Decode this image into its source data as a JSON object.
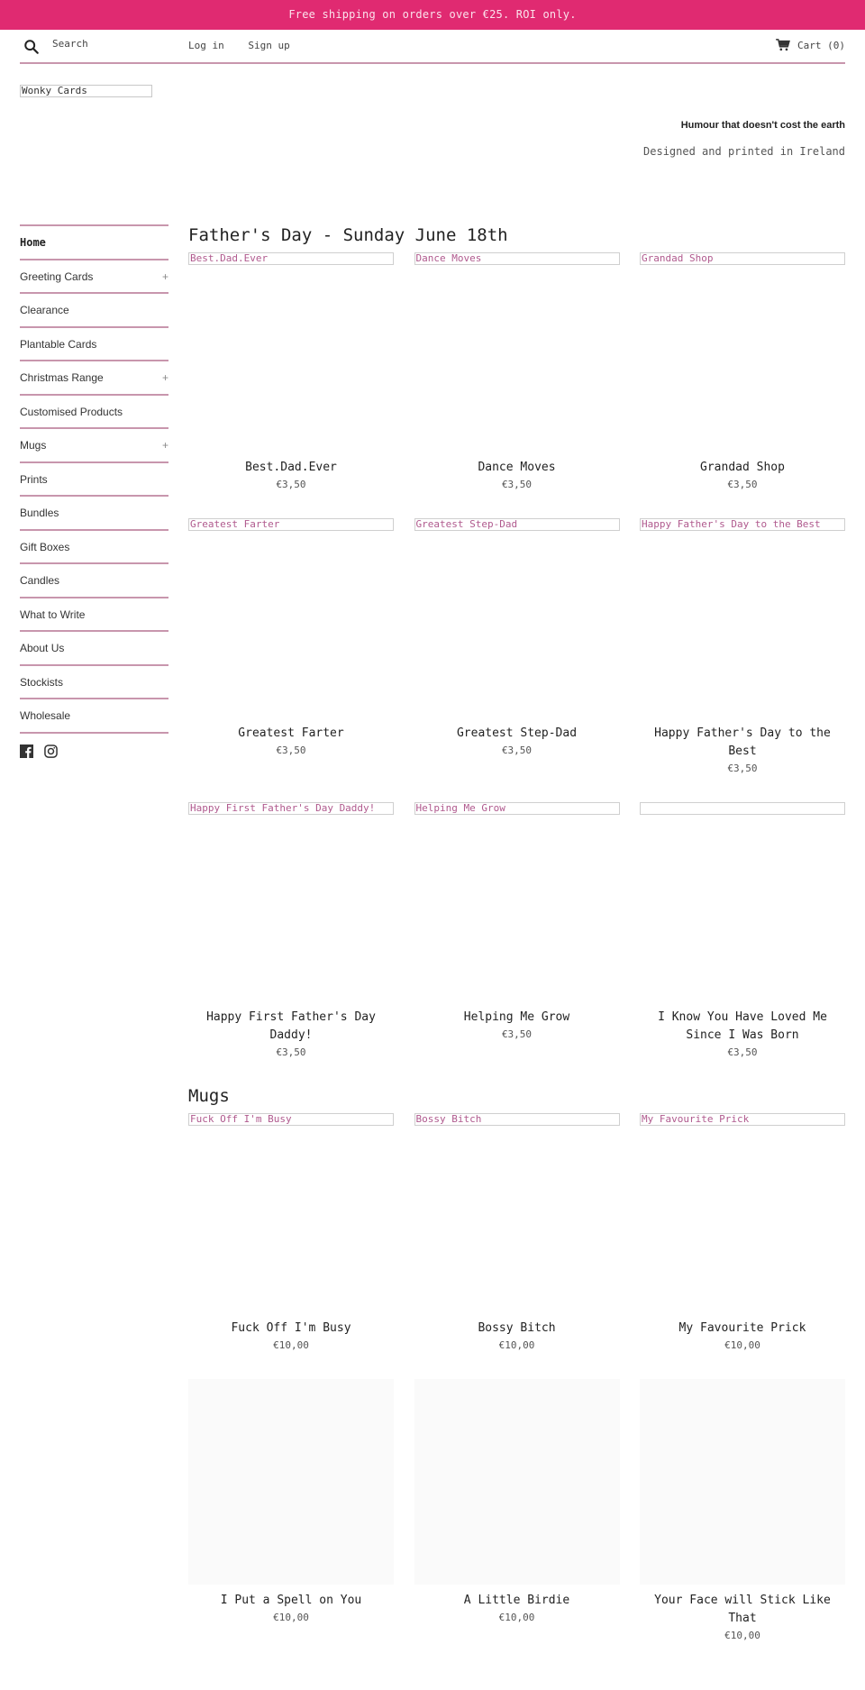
{
  "announcement": "Free shipping on orders over €25. ROI only.",
  "header": {
    "search_placeholder": "Search",
    "login": "Log in",
    "signup": "Sign up",
    "cart": "Cart (0)"
  },
  "store": {
    "logo_alt": "Wonky Cards",
    "tagline": "Humour that doesn't cost the earth",
    "subtag": "Designed and printed in Ireland"
  },
  "sidebar": {
    "items": [
      {
        "label": "Home",
        "active": true,
        "expandable": false
      },
      {
        "label": "Greeting Cards",
        "expandable": true
      },
      {
        "label": "Clearance",
        "expandable": false
      },
      {
        "label": "Plantable Cards",
        "expandable": false
      },
      {
        "label": "Christmas Range",
        "expandable": true
      },
      {
        "label": "Customised Products",
        "expandable": false
      },
      {
        "label": "Mugs",
        "expandable": true
      },
      {
        "label": "Prints",
        "expandable": false
      },
      {
        "label": "Bundles",
        "expandable": false
      },
      {
        "label": "Gift Boxes",
        "expandable": false
      },
      {
        "label": "Candles",
        "expandable": false
      },
      {
        "label": "What to Write",
        "expandable": false
      },
      {
        "label": "About Us",
        "expandable": false
      },
      {
        "label": "Stockists",
        "expandable": false
      },
      {
        "label": "Wholesale",
        "expandable": false
      }
    ],
    "plus": "+",
    "social": [
      "facebook-icon",
      "instagram-icon"
    ]
  },
  "sections": [
    {
      "title": "Father's Day - Sunday June 18th",
      "products": [
        {
          "alt": "Best.Dad.Ever",
          "title": "Best.Dad.Ever",
          "price": "€3,50"
        },
        {
          "alt": "Dance Moves",
          "title": "Dance Moves",
          "price": "€3,50"
        },
        {
          "alt": "Grandad Shop",
          "title": "Grandad Shop",
          "price": "€3,50"
        },
        {
          "alt": "Greatest Farter",
          "title": "Greatest Farter",
          "price": "€3,50"
        },
        {
          "alt": "Greatest Step-Dad",
          "title": "Greatest Step-Dad",
          "price": "€3,50"
        },
        {
          "alt": "Happy Father's Day to the Best",
          "title": "Happy Father's Day to the Best",
          "price": "€3,50"
        },
        {
          "alt": "Happy First Father's Day Daddy!",
          "title": "Happy First Father's Day Daddy!",
          "price": "€3,50"
        },
        {
          "alt": "Helping Me Grow",
          "title": "Helping Me Grow",
          "price": "€3,50"
        },
        {
          "alt": "",
          "title": "I Know You Have Loved Me Since I Was Born",
          "price": "€3,50"
        }
      ]
    },
    {
      "title": "Mugs",
      "products": [
        {
          "alt": "Fuck Off I'm Busy",
          "title": "Fuck Off I'm Busy",
          "price": "€10,00"
        },
        {
          "alt": "Bossy Bitch",
          "title": "Bossy Bitch",
          "price": "€10,00"
        },
        {
          "alt": "My Favourite Prick",
          "title": "My Favourite Prick",
          "price": "€10,00"
        },
        {
          "placeholder": true,
          "title": "I Put a Spell on You",
          "price": "€10,00"
        },
        {
          "placeholder": true,
          "title": "A Little Birdie",
          "price": "€10,00"
        },
        {
          "placeholder": true,
          "title": "Your Face will Stick Like That",
          "price": "€10,00"
        }
      ]
    }
  ],
  "colors": {
    "accent": "#e02a71",
    "divider": "#c896ad",
    "alt_text": "#b05a8e"
  }
}
